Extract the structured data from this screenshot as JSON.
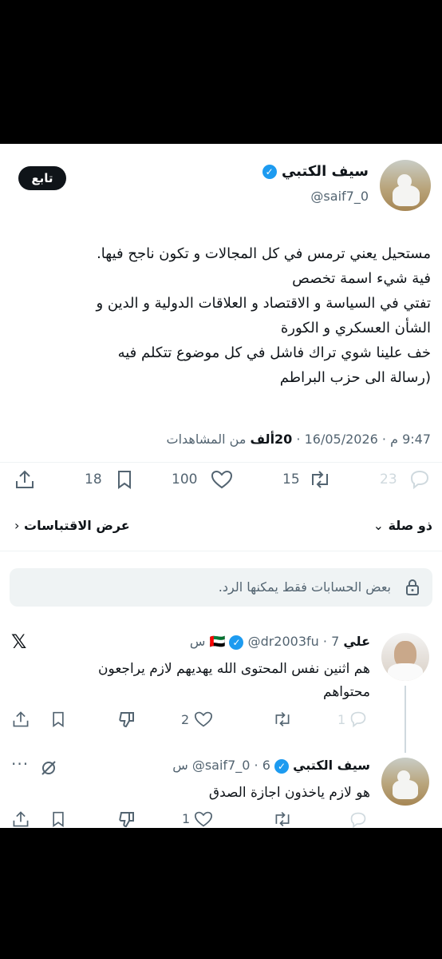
{
  "tweet": {
    "display_name": "سيف الكتبي",
    "handle": "@saif7_0",
    "follow_label": "تابع",
    "lines": [
      "مستحيل يعني ترمس في كل المجالات و تكون ناجح فيها.",
      "فية شيء اسمة تخصص",
      "تفتي في السياسة و الاقتصاد و العلاقات الدولية و الدين و",
      "الشأن العسكري و الكورة",
      "خف علينا شوي تراك فاشل في كل موضوع تتكلم فيه",
      "(رسالة الى حزب البراطم"
    ],
    "time": "9:47 م",
    "date": "16/05/2026",
    "views_count": "20ألف",
    "views_label": "من المشاهدات",
    "replies": "23",
    "retweets": "15",
    "likes": "100",
    "bookmarks": "18",
    "related_label": "ذو صلة",
    "quotes_label": "عرض الاقتباسات"
  },
  "restriction_notice": "بعض الحسابات فقط يمكنها الرد.",
  "replies": [
    {
      "display_name": "علي",
      "flag": "🇦🇪",
      "handle": "@dr2003fu",
      "age": "7 س",
      "text_lines": [
        "هم اثنين نفس المحتوى   الله يهديهم  لازم يراجعون",
        "محتواهم"
      ],
      "replies": "1",
      "likes": "2",
      "retweets": ""
    },
    {
      "display_name": "سيف الكتبي",
      "handle": "@saif7_0",
      "age": "6 س",
      "text_lines": [
        "هو لازم ياخذون اجازة الصدق"
      ],
      "replies": "",
      "likes": "1",
      "retweets": ""
    }
  ],
  "colors": {
    "accent": "#1d9bf0",
    "text": "#0f1419",
    "muted": "#536471",
    "divider": "#eff3f4",
    "notice_bg": "#eff3f4"
  },
  "icons": [
    "verified-badge-icon",
    "reply-icon",
    "retweet-icon",
    "like-icon",
    "bookmark-icon",
    "share-icon",
    "lock-icon",
    "x-logo-icon",
    "dislike-icon",
    "mute-icon",
    "more-icon",
    "chevron-down-icon",
    "chevron-left-icon"
  ]
}
